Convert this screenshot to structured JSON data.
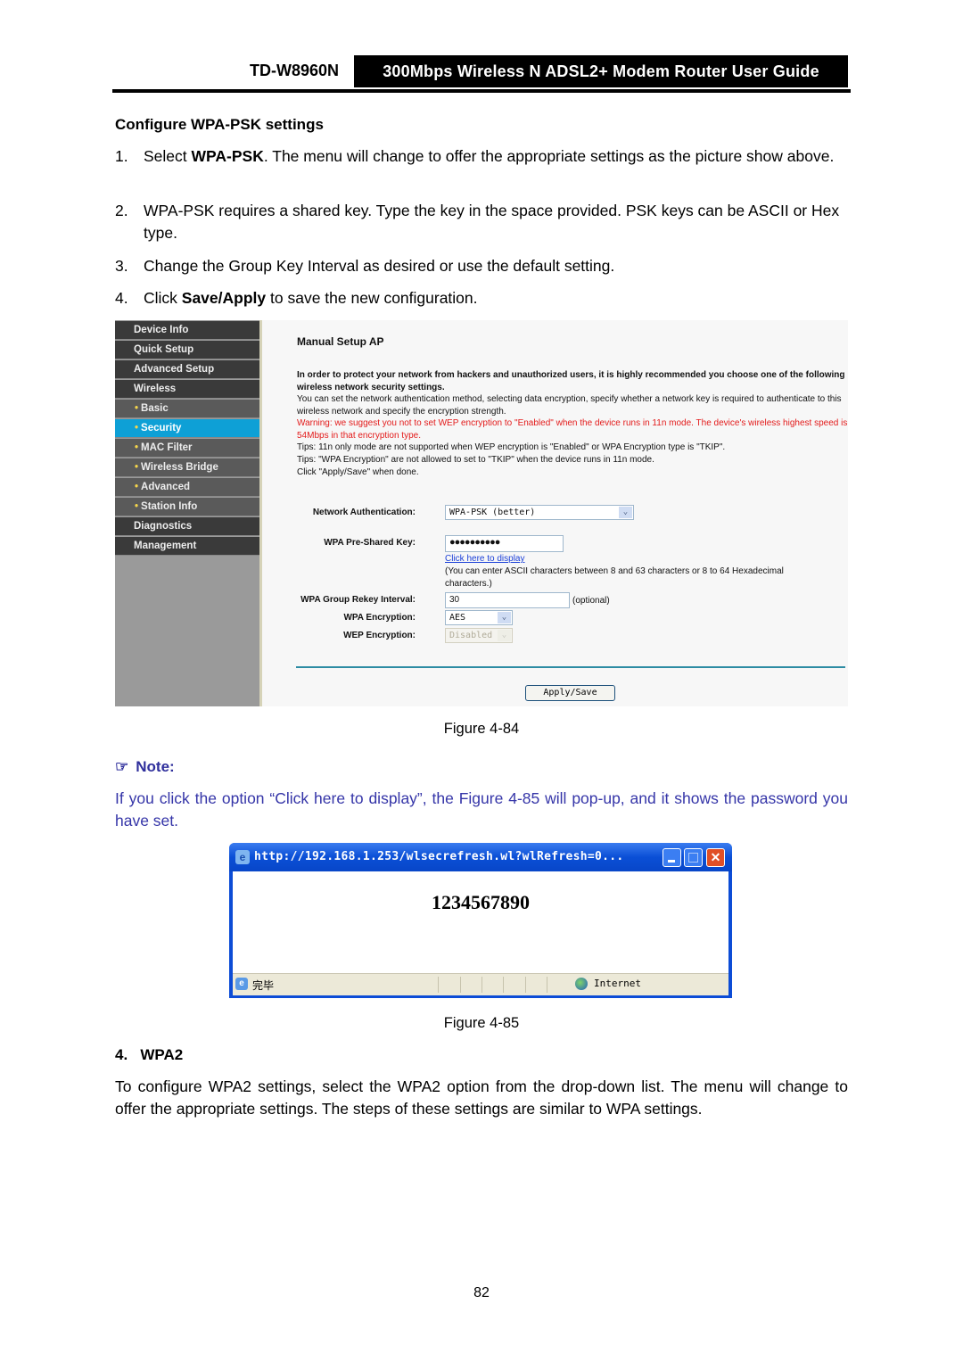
{
  "header": {
    "model": "TD-W8960N",
    "title": "300Mbps Wireless N ADSL2+ Modem Router User Guide"
  },
  "section": {
    "title": "Configure WPA-PSK settings",
    "steps": [
      {
        "num": "1.",
        "pre": "Select ",
        "bold": "WPA-PSK",
        "post": ". The menu will change to offer the appropriate settings as the picture show above."
      },
      {
        "num": "2.",
        "pre": "WPA-PSK requires a shared key. Type the key in the space provided. PSK keys can be ASCII or Hex type.",
        "bold": "",
        "post": ""
      },
      {
        "num": "3.",
        "pre": "Change the Group Key Interval as desired or use the default setting.",
        "bold": "",
        "post": ""
      },
      {
        "num": "4.",
        "pre": "Click ",
        "bold": "Save/Apply",
        "post": " to save the new configuration."
      }
    ]
  },
  "router_ui": {
    "sidebar": [
      {
        "label": "Device Info",
        "sub": false,
        "active": false
      },
      {
        "label": "Quick Setup",
        "sub": false,
        "active": false
      },
      {
        "label": "Advanced Setup",
        "sub": false,
        "active": false
      },
      {
        "label": "Wireless",
        "sub": false,
        "active": false
      },
      {
        "label": "Basic",
        "sub": true,
        "active": false
      },
      {
        "label": "Security",
        "sub": true,
        "active": true
      },
      {
        "label": "MAC Filter",
        "sub": true,
        "active": false
      },
      {
        "label": "Wireless Bridge",
        "sub": true,
        "active": false
      },
      {
        "label": "Advanced",
        "sub": true,
        "active": false
      },
      {
        "label": "Station Info",
        "sub": true,
        "active": false
      },
      {
        "label": "Diagnostics",
        "sub": false,
        "active": false
      },
      {
        "label": "Management",
        "sub": false,
        "active": false
      }
    ],
    "page_title": "Manual Setup AP",
    "intro_bold": "In order to protect your network from hackers and unauthorized users, it is highly recommended you choose one of the following wireless network security settings.",
    "intro_text": "You can set the network authentication method, selecting data encryption, specify whether a network key is required to authenticate to this wireless network and specify the encryption strength.",
    "warning": "Warning: we suggest you not to set WEP encryption to \"Enabled\" when the device runs in 11n mode. The device's wireless highest speed is 54Mbps in that encryption type.",
    "tip1": "Tips: 11n only mode are not supported when WEP encryption is \"Enabled\" or WPA Encryption type is \"TKIP\".",
    "tip2": "Tips: \"WPA Encryption\" are not allowed to set to \"TKIP\" when the device runs in 11n mode.",
    "tip3": "Click \"Apply/Save\" when done.",
    "fields": {
      "auth_label": "Network Authentication:",
      "auth_value": "WPA-PSK (better)",
      "psk_label": "WPA Pre-Shared Key:",
      "psk_value": "●●●●●●●●●●",
      "display_link": "Click here to display",
      "psk_hint": "(You can enter ASCII characters between 8 and 63 characters or 8 to 64 Hexadecimal characters.)",
      "rekey_label": "WPA Group Rekey Interval:",
      "rekey_value": "30",
      "rekey_note": "(optional)",
      "wpa_enc_label": "WPA Encryption:",
      "wpa_enc_value": "AES",
      "wep_enc_label": "WEP Encryption:",
      "wep_enc_value": "Disabled"
    },
    "apply_button": "Apply/Save",
    "arrow_glyph": "⌄"
  },
  "figure1_caption": "Figure 4-84",
  "note": {
    "label": "Note:",
    "icon": "☞",
    "text": "If you click the option “Click here to display”, the Figure 4-85 will pop-up, and it shows the password you have set."
  },
  "popup": {
    "title": "http://192.168.1.253/wlsecrefresh.wl?wlRefresh=0...",
    "ie_icon": "e",
    "close_glyph": "✕",
    "password": "1234567890",
    "status_left": "完毕",
    "status_zone": "Internet"
  },
  "figure2_caption": "Figure 4-85",
  "wpa2": {
    "heading": "4.   WPA2",
    "text": "To configure WPA2 settings, select the WPA2 option from the drop-down list. The menu will change to offer the appropriate settings. The steps of these settings are similar to WPA settings."
  },
  "page_number": "82"
}
